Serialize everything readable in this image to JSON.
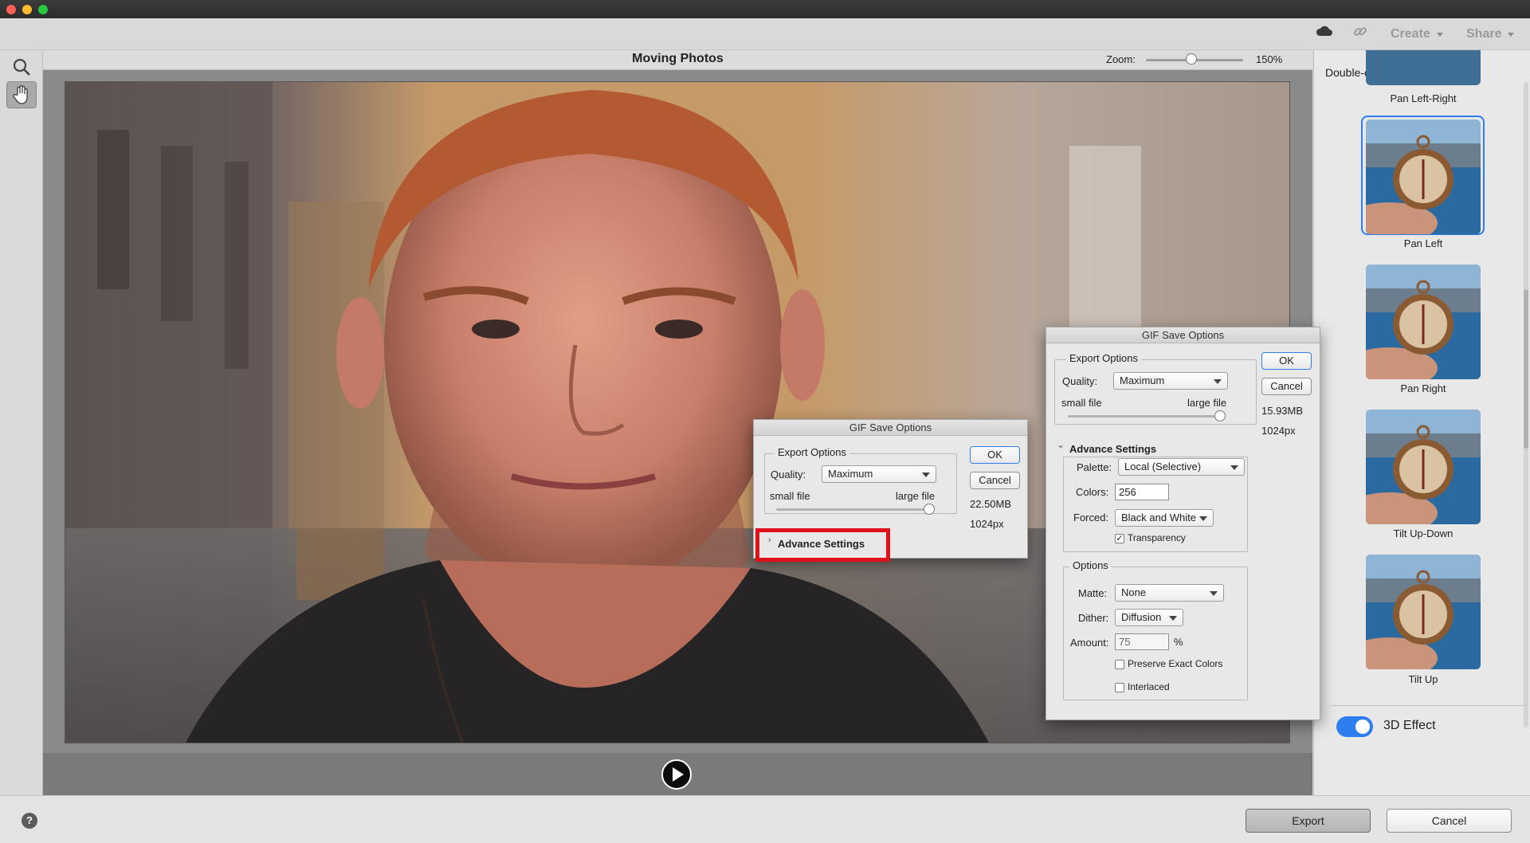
{
  "toolbar": {
    "create_label": "Create",
    "share_label": "Share"
  },
  "canvas": {
    "title": "Moving Photos",
    "zoom_label": "Zoom:",
    "zoom_value": "150%",
    "zoom_fraction": 0.47
  },
  "effects_panel": {
    "hint": "Double-click to apply effect",
    "items": [
      {
        "label": "Pan Left-Right",
        "selected": false
      },
      {
        "label": "Pan Left",
        "selected": true
      },
      {
        "label": "Pan Right",
        "selected": false
      },
      {
        "label": "Tilt Up-Down",
        "selected": false
      },
      {
        "label": "Tilt Up",
        "selected": false
      }
    ],
    "effect3d_label": "3D Effect",
    "effect3d_on": true
  },
  "dialog_small": {
    "title": "GIF Save Options",
    "export_options_label": "Export Options",
    "quality_label": "Quality:",
    "quality_value": "Maximum",
    "small_file_label": "small file",
    "large_file_label": "large file",
    "ok_label": "OK",
    "cancel_label": "Cancel",
    "file_size": "22.50MB",
    "dimension": "1024px",
    "advance_settings_label": "Advance Settings",
    "advance_settings_expander": "›"
  },
  "dialog_large": {
    "title": "GIF Save Options",
    "export_options_label": "Export Options",
    "quality_label": "Quality:",
    "quality_value": "Maximum",
    "small_file_label": "small file",
    "large_file_label": "large file",
    "ok_label": "OK",
    "cancel_label": "Cancel",
    "file_size": "15.93MB",
    "dimension": "1024px",
    "advance_settings_label": "Advance Settings",
    "advance_settings_expander": "⌄",
    "palette_label": "Palette:",
    "palette_value": "Local (Selective)",
    "colors_label": "Colors:",
    "colors_value": "256",
    "forced_label": "Forced:",
    "forced_value": "Black and White",
    "transparency_label": "Transparency",
    "transparency_checked": true,
    "options_label": "Options",
    "matte_label": "Matte:",
    "matte_value": "None",
    "dither_label": "Dither:",
    "dither_value": "Diffusion",
    "amount_label": "Amount:",
    "amount_value": "75",
    "amount_unit": "%",
    "preserve_label": "Preserve Exact Colors",
    "preserve_checked": false,
    "interlaced_label": "Interlaced",
    "interlaced_checked": false
  },
  "footer": {
    "help_label": "?",
    "export_label": "Export",
    "cancel_label": "Cancel"
  },
  "colors": {
    "accent": "#2f7ef0",
    "highlight_red": "#e0101a"
  }
}
